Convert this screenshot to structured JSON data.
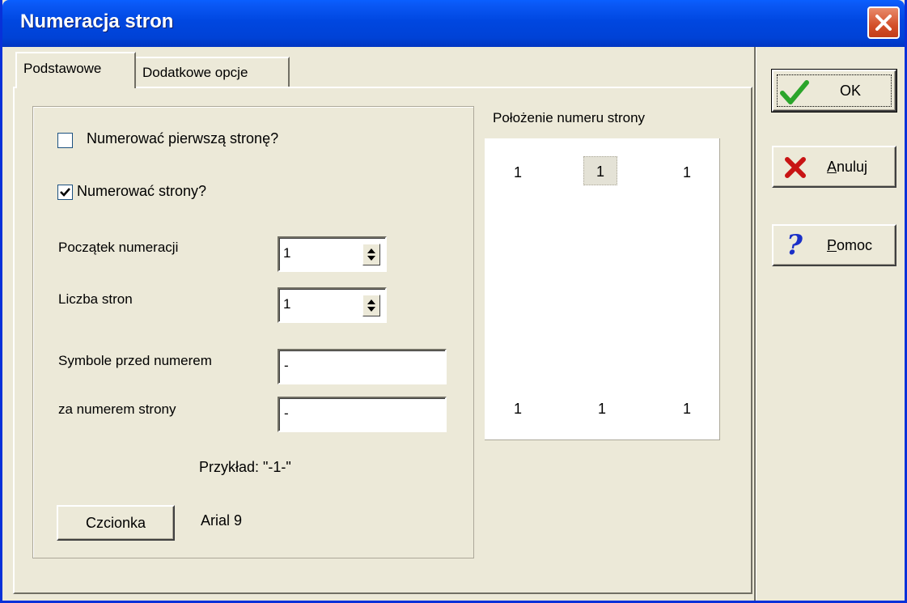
{
  "window": {
    "title": "Numeracja stron"
  },
  "tabs": [
    {
      "label": "Podstawowe",
      "active": true
    },
    {
      "label": "Dodatkowe opcje",
      "active": false
    }
  ],
  "options": {
    "number_first_page": {
      "label": "Numerować pierwszą stronę?",
      "checked": false
    },
    "number_pages": {
      "label": "Numerować strony?",
      "checked": true
    }
  },
  "fields": {
    "start_label": "Początek numeracji",
    "start_value": "1",
    "count_label": "Liczba stron",
    "count_value": "1",
    "before_label": "Symbole przed numerem",
    "before_value": "-",
    "after_label": "za numerem strony",
    "after_value": "-"
  },
  "example": {
    "text": "Przykład: \"-1-\""
  },
  "font": {
    "button_label": "Czcionka",
    "value": "Arial 9"
  },
  "position": {
    "title": "Położenie numeru strony",
    "top": [
      "1",
      "1",
      "1"
    ],
    "bottom": [
      "1",
      "1",
      "1"
    ],
    "selected": "top-center"
  },
  "actions": {
    "ok": "OK",
    "cancel_underline": "A",
    "cancel_rest": "nuluj",
    "help_underline": "P",
    "help_rest": "omoc"
  },
  "colors": {
    "titlebar": "#0047e0",
    "ok_check": "#2ba52b",
    "cancel_x": "#c81414",
    "help_q": "#1a2fc8"
  }
}
